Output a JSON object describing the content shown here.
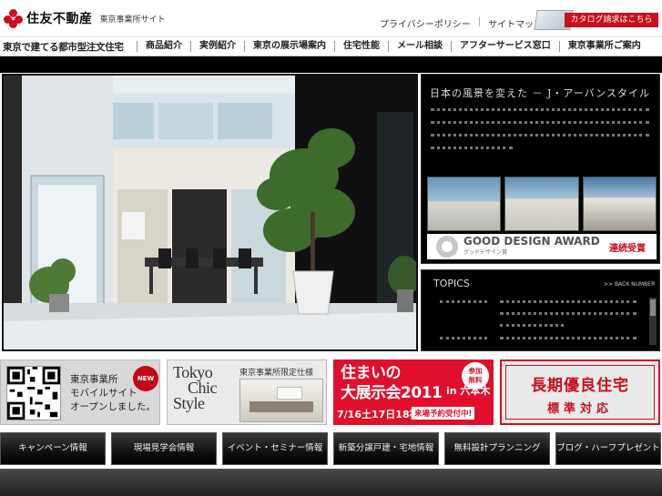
{
  "header": {
    "brand": "住友不動産",
    "site_name": "東京事業所サイト",
    "privacy_link": "プライバシーポリシー",
    "sitemap_link": "サイトマップ",
    "separator": "|",
    "catalog_button": "カタログ請求はこちら"
  },
  "nav": {
    "tagline": "東京で建てる都市型注文住宅",
    "items": [
      {
        "label": "商品紹介"
      },
      {
        "label": "実例紹介"
      },
      {
        "label": "東京の展示場案内"
      },
      {
        "label": "住宅性能"
      },
      {
        "label": "メール相談"
      },
      {
        "label": "アフターサービス窓口"
      },
      {
        "label": "東京事業所ご案内"
      }
    ]
  },
  "feature": {
    "title": "日本の風景を変えた － J・アーバンスタイル",
    "award_title": "GOOD DESIGN AWARD",
    "award_subtitle": "グッドデザイン賞",
    "award_badge": "連続受賞"
  },
  "topics": {
    "heading": "TOPICS",
    "back_number": ">> BACK NUMBER"
  },
  "banners": {
    "mobile_title": "東京事業所",
    "mobile_line2": "モバイルサイト",
    "mobile_line3": "オープンしました。",
    "new_badge": "NEW",
    "tokyo_1": "Tokyo",
    "tokyo_2": "Chic",
    "tokyo_3": "Style",
    "limited_spec": "東京事業所限定仕様",
    "expo_line1": "住まいの",
    "expo_line2": "大展示会2011",
    "expo_free_1": "参加",
    "expo_free_2": "無料",
    "expo_in": "in 六本木",
    "expo_dates": "7/16土17日18祝",
    "expo_reserve": "来場予約受付中!",
    "longlife_1": "長期優良住宅",
    "longlife_2": "標準対応"
  },
  "bottom_nav": [
    {
      "label": "キャンペーン情報"
    },
    {
      "label": "現場見学会情報"
    },
    {
      "label": "イベント・セミナー情報"
    },
    {
      "label": "新築分譲戸建・宅地情報"
    },
    {
      "label": "無料設計プランニング"
    },
    {
      "label": "ブログ・ハーフプレゼント"
    }
  ],
  "colors": {
    "brand_red": "#c8101e",
    "panel_bg": "#000000"
  }
}
